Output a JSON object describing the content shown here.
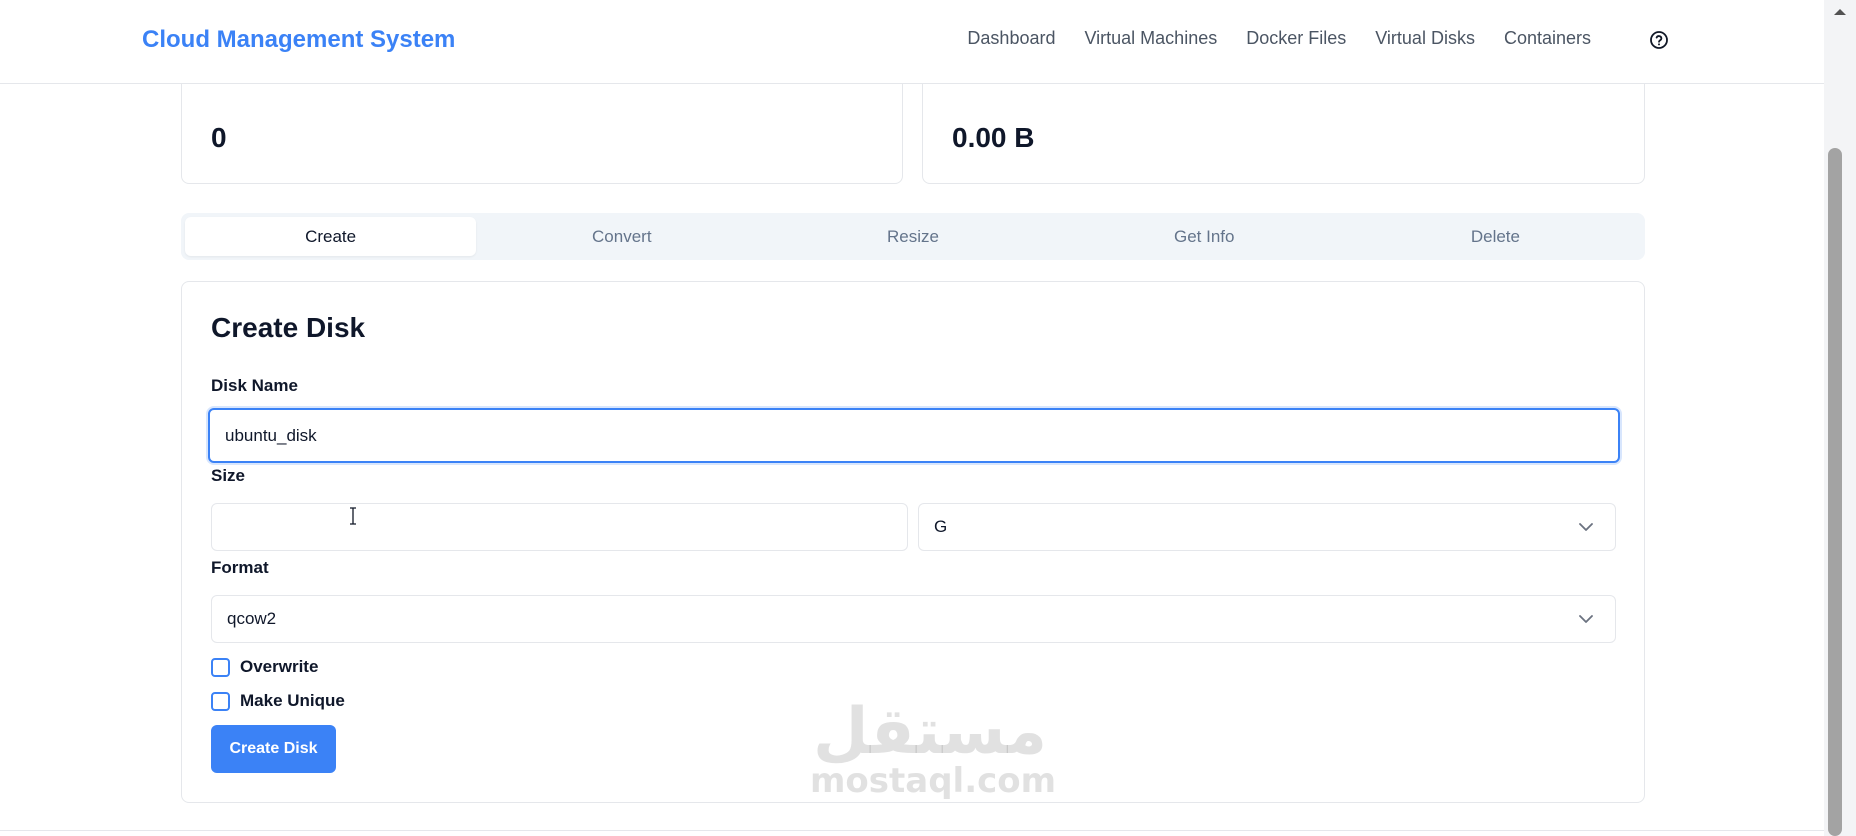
{
  "nav": {
    "brand": "Cloud Management System",
    "links": [
      "Dashboard",
      "Virtual Machines",
      "Docker Files",
      "Virtual Disks",
      "Containers"
    ],
    "help_icon": "question-circle-icon"
  },
  "stats": {
    "left_value": "0",
    "right_value": "0.00 B"
  },
  "tabs": [
    {
      "label": "Create",
      "active": true
    },
    {
      "label": "Convert",
      "active": false
    },
    {
      "label": "Resize",
      "active": false
    },
    {
      "label": "Get Info",
      "active": false
    },
    {
      "label": "Delete",
      "active": false
    }
  ],
  "form": {
    "title": "Create Disk",
    "disk_name_label": "Disk Name",
    "disk_name_value": "ubuntu_disk",
    "size_label": "Size",
    "size_value": "",
    "size_unit": "G",
    "format_label": "Format",
    "format_value": "qcow2",
    "overwrite_label": "Overwrite",
    "make_unique_label": "Make Unique",
    "submit_label": "Create Disk"
  },
  "watermark": {
    "arabic": "مستقل",
    "latin": "mostaql.com"
  },
  "colors": {
    "accent": "#3b82f6",
    "text": "#0f172a",
    "muted": "#64748b",
    "border": "#e5e7eb",
    "tabs_bg": "#f1f5f9"
  }
}
